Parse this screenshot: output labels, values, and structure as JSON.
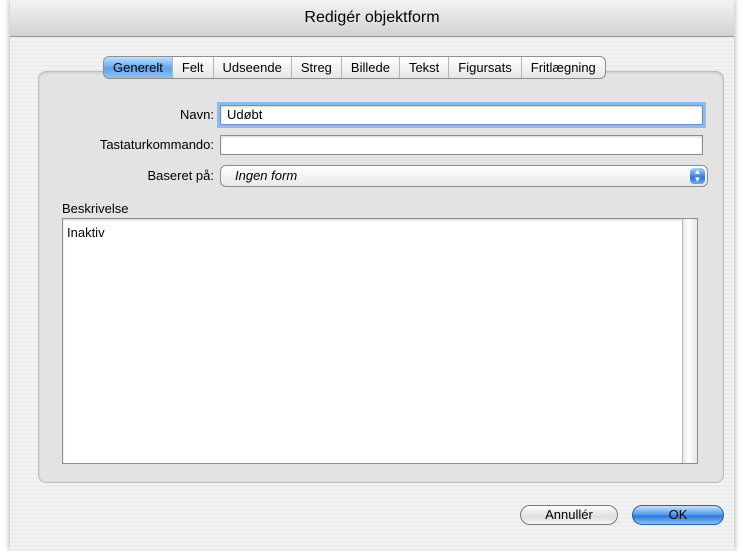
{
  "window": {
    "title": "Redigér objektform"
  },
  "tabs": [
    {
      "label": "Generelt",
      "active": true
    },
    {
      "label": "Felt"
    },
    {
      "label": "Udseende"
    },
    {
      "label": "Streg"
    },
    {
      "label": "Billede"
    },
    {
      "label": "Tekst"
    },
    {
      "label": "Figursats"
    },
    {
      "label": "Fritlægning"
    }
  ],
  "form": {
    "name_label": "Navn:",
    "name_value": "Udøbt",
    "shortcut_label": "Tastaturkommando:",
    "shortcut_value": "",
    "based_on_label": "Baseret på:",
    "based_on_value": "Ingen form",
    "description_label": "Beskrivelse",
    "description_text": "Inaktiv"
  },
  "buttons": {
    "cancel": "Annullér",
    "ok": "OK"
  },
  "colors": {
    "accent": "#3d86e0",
    "focus_ring": "#8fb9ea"
  }
}
